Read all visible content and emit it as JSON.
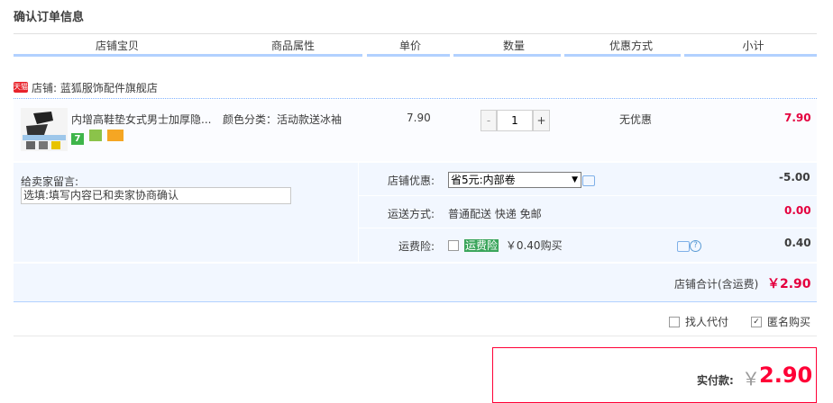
{
  "page": {
    "title": "确认订单信息"
  },
  "table_header": [
    "店铺宝贝",
    "商品属性",
    "单价",
    "数量",
    "优惠方式",
    "小计"
  ],
  "shop": {
    "badge": "天猫",
    "name": "店铺: 蓝狐服饰配件旗舰店"
  },
  "item": {
    "name": "内增高鞋垫女式男士加厚隐...",
    "attr": "颜色分类：活动款送冰袖",
    "price": "7.90",
    "qty": "1",
    "minus": "-",
    "plus": "+",
    "discount": "无优惠",
    "subtotal": "7.90",
    "tags": [
      "7",
      "",
      ""
    ],
    "tag_colors": [
      "#3eb54a",
      "#8bc34a",
      "#f5a623"
    ]
  },
  "options": {
    "message_label": "给卖家留言:",
    "message_value": "选填:填写内容已和卖家协商确认",
    "coupon_label": "店铺优惠:",
    "coupon_value": "省5元:内部卷",
    "coupon_amount": "-5.00",
    "shipping_label": "运送方式:",
    "shipping_value": "普通配送 快递 免邮",
    "shipping_amount": "0.00",
    "insurance_label": "运费险:",
    "insurance_tag": "运费险",
    "insurance_price": "￥0.40购买",
    "insurance_amount": "0.40"
  },
  "summary": {
    "shop_total_label": "店铺合计(含运费)",
    "shop_total_value": "￥2.90",
    "proxy_pay": "找人代付",
    "anonymous": "匿名购买"
  },
  "pay": {
    "label": "实付款:",
    "currency": "￥",
    "value": "2.90"
  }
}
